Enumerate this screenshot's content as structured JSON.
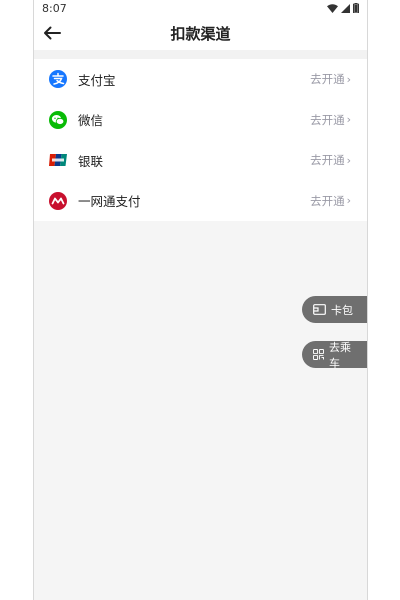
{
  "status_bar": {
    "time": "8:07"
  },
  "header": {
    "title": "扣款渠道"
  },
  "channels": [
    {
      "label": "支付宝",
      "action": "去开通",
      "icon": "alipay-icon",
      "color": "#1677ff"
    },
    {
      "label": "微信",
      "action": "去开通",
      "icon": "wechat-icon",
      "color": "#09bb07"
    },
    {
      "label": "银联",
      "action": "去开通",
      "icon": "unionpay-icon",
      "color": "#d81e06"
    },
    {
      "label": "一网通支付",
      "action": "去开通",
      "icon": "cmb-icon",
      "color": "#c8102e"
    }
  ],
  "floating": {
    "card_label": "卡包",
    "ride_label": "去乘车"
  }
}
